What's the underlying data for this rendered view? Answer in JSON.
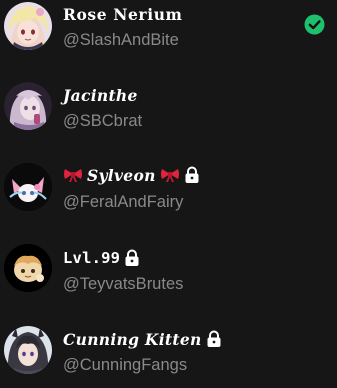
{
  "accounts": [
    {
      "display_name": "Rose Nerium",
      "handle": "@SlashAndBite",
      "style": "serif",
      "locked": false,
      "selected": true,
      "avatar_icon": "anime-girl-pink-hair-avatar"
    },
    {
      "display_name": "Jacinthe",
      "handle": "@SBCbrat",
      "style": "script",
      "locked": false,
      "selected": false,
      "avatar_icon": "anime-girl-purple-hair-avatar"
    },
    {
      "display_name": "Sylveon",
      "handle": "@FeralAndFairy",
      "style": "script",
      "locked": true,
      "selected": false,
      "prefix_icon": "red-bow-icon",
      "suffix_icon": "red-bow-icon",
      "avatar_icon": "sylveon-avatar"
    },
    {
      "display_name": "Lvl.99",
      "handle": "@TeyvatsBrutes",
      "style": "mono",
      "locked": true,
      "selected": false,
      "avatar_icon": "chibi-creature-avatar"
    },
    {
      "display_name": "Cunning Kitten",
      "handle": "@CunningFangs",
      "style": "script",
      "locked": true,
      "selected": false,
      "avatar_icon": "anime-girl-dark-hair-avatar"
    }
  ],
  "colors": {
    "background": "#161616",
    "name_text": "#ffffff",
    "handle_text": "#898989",
    "selected_check": "#1ebf6d",
    "bow_red": "#e0243d"
  }
}
